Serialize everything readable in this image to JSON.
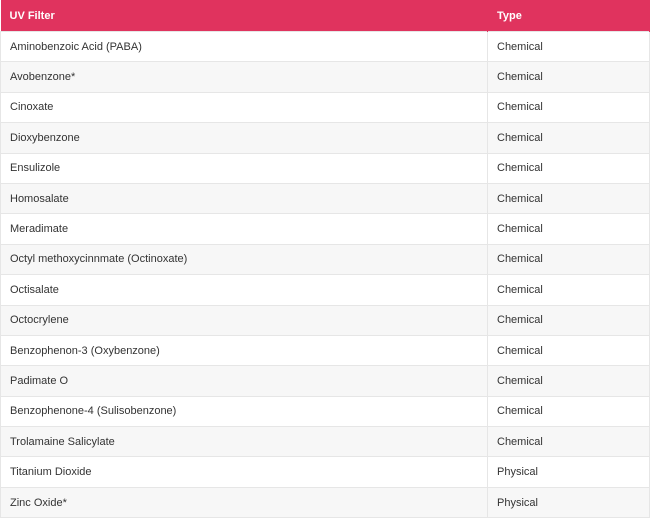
{
  "table": {
    "headers": [
      "UV Filter",
      "Type"
    ],
    "header_color": "#e0335e",
    "rows": [
      {
        "filter": "Aminobenzoic Acid (PABA)",
        "type": "Chemical"
      },
      {
        "filter": "Avobenzone*",
        "type": "Chemical"
      },
      {
        "filter": "Cinoxate",
        "type": "Chemical"
      },
      {
        "filter": "Dioxybenzone",
        "type": "Chemical"
      },
      {
        "filter": "Ensulizole",
        "type": "Chemical"
      },
      {
        "filter": "Homosalate",
        "type": "Chemical"
      },
      {
        "filter": "Meradimate",
        "type": "Chemical"
      },
      {
        "filter": "Octyl methoxycinnmate (Octinoxate)",
        "type": "Chemical"
      },
      {
        "filter": "Octisalate",
        "type": "Chemical"
      },
      {
        "filter": "Octocrylene",
        "type": "Chemical"
      },
      {
        "filter": "Benzophenon-3 (Oxybenzone)",
        "type": "Chemical"
      },
      {
        "filter": "Padimate O",
        "type": "Chemical"
      },
      {
        "filter": "Benzophenone-4 (Sulisobenzone)",
        "type": "Chemical"
      },
      {
        "filter": "Trolamaine Salicylate",
        "type": "Chemical"
      },
      {
        "filter": "Titanium Dioxide",
        "type": "Physical"
      },
      {
        "filter": "Zinc Oxide*",
        "type": "Physical"
      }
    ]
  }
}
